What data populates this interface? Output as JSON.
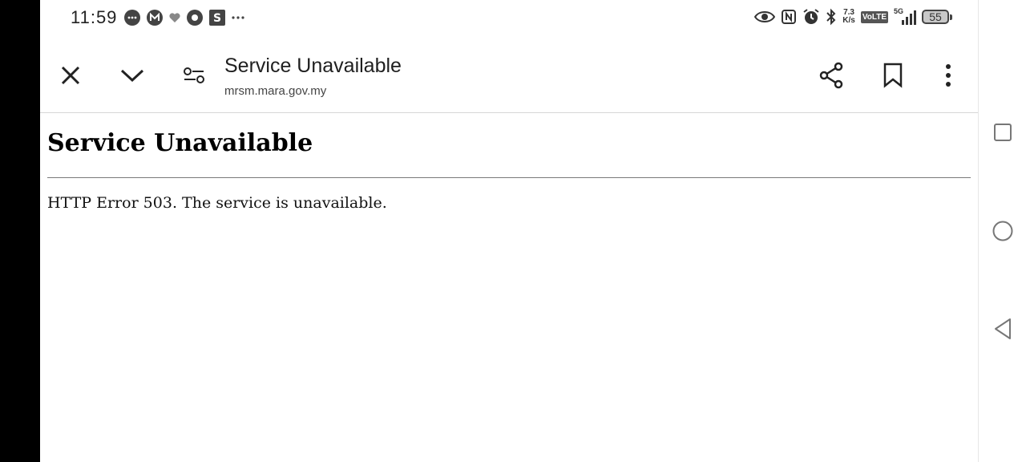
{
  "status_bar": {
    "time": "11:59",
    "net_speed_value": "7.3",
    "net_speed_unit": "K/s",
    "volte": "VoLTE",
    "network": "5G",
    "battery": "55"
  },
  "toolbar": {
    "title": "Service Unavailable",
    "url": "mrsm.mara.gov.my"
  },
  "page": {
    "heading": "Service Unavailable",
    "message": "HTTP Error 503. The service is unavailable."
  },
  "icons": {
    "close": "close-icon",
    "collapse": "chevron-down-icon",
    "site_settings": "tune-icon",
    "share": "share-icon",
    "bookmark": "bookmark-icon",
    "menu": "more-vert-icon"
  }
}
